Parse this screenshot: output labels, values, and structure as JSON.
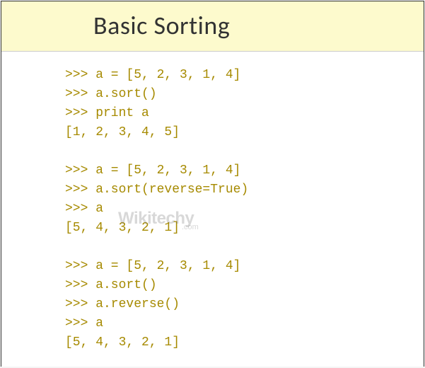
{
  "header": {
    "title": "Basic Sorting"
  },
  "code": {
    "lines": [
      ">>> a = [5, 2, 3, 1, 4]",
      ">>> a.sort()",
      ">>> print a",
      "[1, 2, 3, 4, 5]",
      "",
      ">>> a = [5, 2, 3, 1, 4]",
      ">>> a.sort(reverse=True)",
      ">>> a",
      "[5, 4, 3, 2, 1]",
      "",
      ">>> a = [5, 2, 3, 1, 4]",
      ">>> a.sort()",
      ">>> a.reverse()",
      ">>> a",
      "[5, 4, 3, 2, 1]"
    ]
  },
  "watermark": {
    "main": "Wikitechy",
    "sub": ".com"
  }
}
